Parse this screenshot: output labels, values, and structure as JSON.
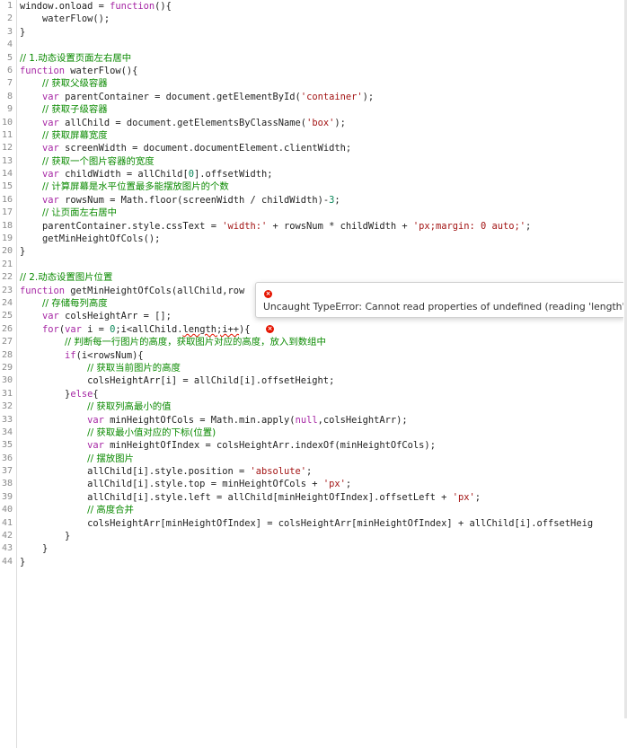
{
  "editor": {
    "lines": [
      {
        "n": "1",
        "segs": [
          {
            "t": "window.onload = "
          },
          {
            "t": "function",
            "c": "kw"
          },
          {
            "t": "(){"
          }
        ]
      },
      {
        "n": "2",
        "segs": [
          {
            "t": "    waterFlow();"
          }
        ]
      },
      {
        "n": "3",
        "segs": [
          {
            "t": "}"
          }
        ]
      },
      {
        "n": "4",
        "segs": []
      },
      {
        "n": "5",
        "segs": [
          {
            "t": "// 1.动态设置页面左右居中",
            "c": "cm"
          }
        ]
      },
      {
        "n": "6",
        "segs": [
          {
            "t": "function",
            "c": "kw"
          },
          {
            "t": " waterFlow(){"
          }
        ]
      },
      {
        "n": "7",
        "segs": [
          {
            "t": "    "
          },
          {
            "t": "// 获取父级容器",
            "c": "cm"
          }
        ]
      },
      {
        "n": "8",
        "segs": [
          {
            "t": "    "
          },
          {
            "t": "var",
            "c": "kw"
          },
          {
            "t": " parentContainer = document.getElementById("
          },
          {
            "t": "'container'",
            "c": "str"
          },
          {
            "t": ");"
          }
        ]
      },
      {
        "n": "9",
        "segs": [
          {
            "t": "    "
          },
          {
            "t": "// 获取子级容器",
            "c": "cm"
          }
        ]
      },
      {
        "n": "10",
        "segs": [
          {
            "t": "    "
          },
          {
            "t": "var",
            "c": "kw"
          },
          {
            "t": " allChild = document.getElementsByClassName("
          },
          {
            "t": "'box'",
            "c": "str"
          },
          {
            "t": ");"
          }
        ]
      },
      {
        "n": "11",
        "segs": [
          {
            "t": "    "
          },
          {
            "t": "// 获取屏幕宽度",
            "c": "cm"
          }
        ]
      },
      {
        "n": "12",
        "segs": [
          {
            "t": "    "
          },
          {
            "t": "var",
            "c": "kw"
          },
          {
            "t": " screenWidth = document.documentElement.clientWidth;"
          }
        ]
      },
      {
        "n": "13",
        "segs": [
          {
            "t": "    "
          },
          {
            "t": "// 获取一个图片容器的宽度",
            "c": "cm"
          }
        ]
      },
      {
        "n": "14",
        "segs": [
          {
            "t": "    "
          },
          {
            "t": "var",
            "c": "kw"
          },
          {
            "t": " childWidth = allChild["
          },
          {
            "t": "0",
            "c": "num"
          },
          {
            "t": "].offsetWidth;"
          }
        ]
      },
      {
        "n": "15",
        "segs": [
          {
            "t": "    "
          },
          {
            "t": "// 计算屏幕是水平位置最多能摆放图片的个数",
            "c": "cm"
          }
        ]
      },
      {
        "n": "16",
        "segs": [
          {
            "t": "    "
          },
          {
            "t": "var",
            "c": "kw"
          },
          {
            "t": " rowsNum = Math.floor(screenWidth / childWidth)-"
          },
          {
            "t": "3",
            "c": "num"
          },
          {
            "t": ";"
          }
        ]
      },
      {
        "n": "17",
        "segs": [
          {
            "t": "    "
          },
          {
            "t": "// 让页面左右居中",
            "c": "cm"
          }
        ]
      },
      {
        "n": "18",
        "segs": [
          {
            "t": "    parentContainer.style.cssText = "
          },
          {
            "t": "'width:'",
            "c": "str"
          },
          {
            "t": " + rowsNum * childWidth + "
          },
          {
            "t": "'px;margin: 0 auto;'",
            "c": "str"
          },
          {
            "t": ";"
          }
        ]
      },
      {
        "n": "19",
        "segs": [
          {
            "t": "    getMinHeightOfCols();"
          }
        ]
      },
      {
        "n": "20",
        "segs": [
          {
            "t": "}"
          }
        ]
      },
      {
        "n": "21",
        "segs": []
      },
      {
        "n": "22",
        "segs": [
          {
            "t": "// 2.动态设置图片位置",
            "c": "cm"
          }
        ]
      },
      {
        "n": "23",
        "segs": [
          {
            "t": "function",
            "c": "kw"
          },
          {
            "t": " getMinHeightOfCols(allChild,row"
          }
        ]
      },
      {
        "n": "24",
        "segs": [
          {
            "t": "    "
          },
          {
            "t": "// 存储每列高度",
            "c": "cm"
          }
        ]
      },
      {
        "n": "25",
        "segs": [
          {
            "t": "    "
          },
          {
            "t": "var",
            "c": "kw"
          },
          {
            "t": " colsHeightArr = [];"
          }
        ]
      },
      {
        "n": "26",
        "segs": [
          {
            "t": "    "
          },
          {
            "t": "for",
            "c": "kw"
          },
          {
            "t": "("
          },
          {
            "t": "var",
            "c": "kw"
          },
          {
            "t": " i = "
          },
          {
            "t": "0",
            "c": "num"
          },
          {
            "t": ";i<allChild."
          },
          {
            "t": "length;i++",
            "c": "squiggle"
          },
          {
            "t": "){"
          }
        ]
      },
      {
        "n": "27",
        "segs": [
          {
            "t": "        "
          },
          {
            "t": "// 判断每一行图片的高度，获取图片对应的高度，放入到数组中",
            "c": "cm"
          }
        ]
      },
      {
        "n": "28",
        "segs": [
          {
            "t": "        "
          },
          {
            "t": "if",
            "c": "kw"
          },
          {
            "t": "(i<rowsNum){"
          }
        ]
      },
      {
        "n": "29",
        "segs": [
          {
            "t": "            "
          },
          {
            "t": "// 获取当前图片的高度",
            "c": "cm"
          }
        ]
      },
      {
        "n": "30",
        "segs": [
          {
            "t": "            colsHeightArr[i] = allChild[i].offsetHeight;"
          }
        ]
      },
      {
        "n": "31",
        "segs": [
          {
            "t": "        }"
          },
          {
            "t": "else",
            "c": "kw"
          },
          {
            "t": "{"
          }
        ]
      },
      {
        "n": "32",
        "segs": [
          {
            "t": "            "
          },
          {
            "t": "// 获取列高最小的值",
            "c": "cm"
          }
        ]
      },
      {
        "n": "33",
        "segs": [
          {
            "t": "            "
          },
          {
            "t": "var",
            "c": "kw"
          },
          {
            "t": " minHeightOfCols = Math.min.apply("
          },
          {
            "t": "null",
            "c": "kw"
          },
          {
            "t": ",colsHeightArr);"
          }
        ]
      },
      {
        "n": "34",
        "segs": [
          {
            "t": "            "
          },
          {
            "t": "// 获取最小值对应的下标(位置)",
            "c": "cm"
          }
        ]
      },
      {
        "n": "35",
        "segs": [
          {
            "t": "            "
          },
          {
            "t": "var",
            "c": "kw"
          },
          {
            "t": " minHeightOfIndex = colsHeightArr.indexOf(minHeightOfCols);"
          }
        ]
      },
      {
        "n": "36",
        "segs": [
          {
            "t": "            "
          },
          {
            "t": "// 摆放图片",
            "c": "cm"
          }
        ]
      },
      {
        "n": "37",
        "segs": [
          {
            "t": "            allChild[i].style.position = "
          },
          {
            "t": "'absolute'",
            "c": "str"
          },
          {
            "t": ";"
          }
        ]
      },
      {
        "n": "38",
        "segs": [
          {
            "t": "            allChild[i].style.top = minHeightOfCols + "
          },
          {
            "t": "'px'",
            "c": "str"
          },
          {
            "t": ";"
          }
        ]
      },
      {
        "n": "39",
        "segs": [
          {
            "t": "            allChild[i].style.left = allChild[minHeightOfIndex].offsetLeft + "
          },
          {
            "t": "'px'",
            "c": "str"
          },
          {
            "t": ";"
          }
        ]
      },
      {
        "n": "40",
        "segs": [
          {
            "t": "            "
          },
          {
            "t": "// 高度合并",
            "c": "cm"
          }
        ]
      },
      {
        "n": "41",
        "segs": [
          {
            "t": "            colsHeightArr[minHeightOfIndex] = colsHeightArr[minHeightOfIndex] + allChild[i].offsetHeig"
          }
        ]
      },
      {
        "n": "42",
        "segs": [
          {
            "t": "        }"
          }
        ]
      },
      {
        "n": "43",
        "segs": [
          {
            "t": "    }"
          }
        ]
      },
      {
        "n": "44",
        "segs": [
          {
            "t": "}"
          }
        ]
      }
    ]
  },
  "error": {
    "icon": "error-icon",
    "icon_glyph": "×",
    "message": "Uncaught TypeError: Cannot read properties of undefined (reading 'length')"
  },
  "colors": {
    "keyword": "#a626a4",
    "comment": "#0a8a00",
    "string": "#a31515",
    "error": "#e51400"
  }
}
